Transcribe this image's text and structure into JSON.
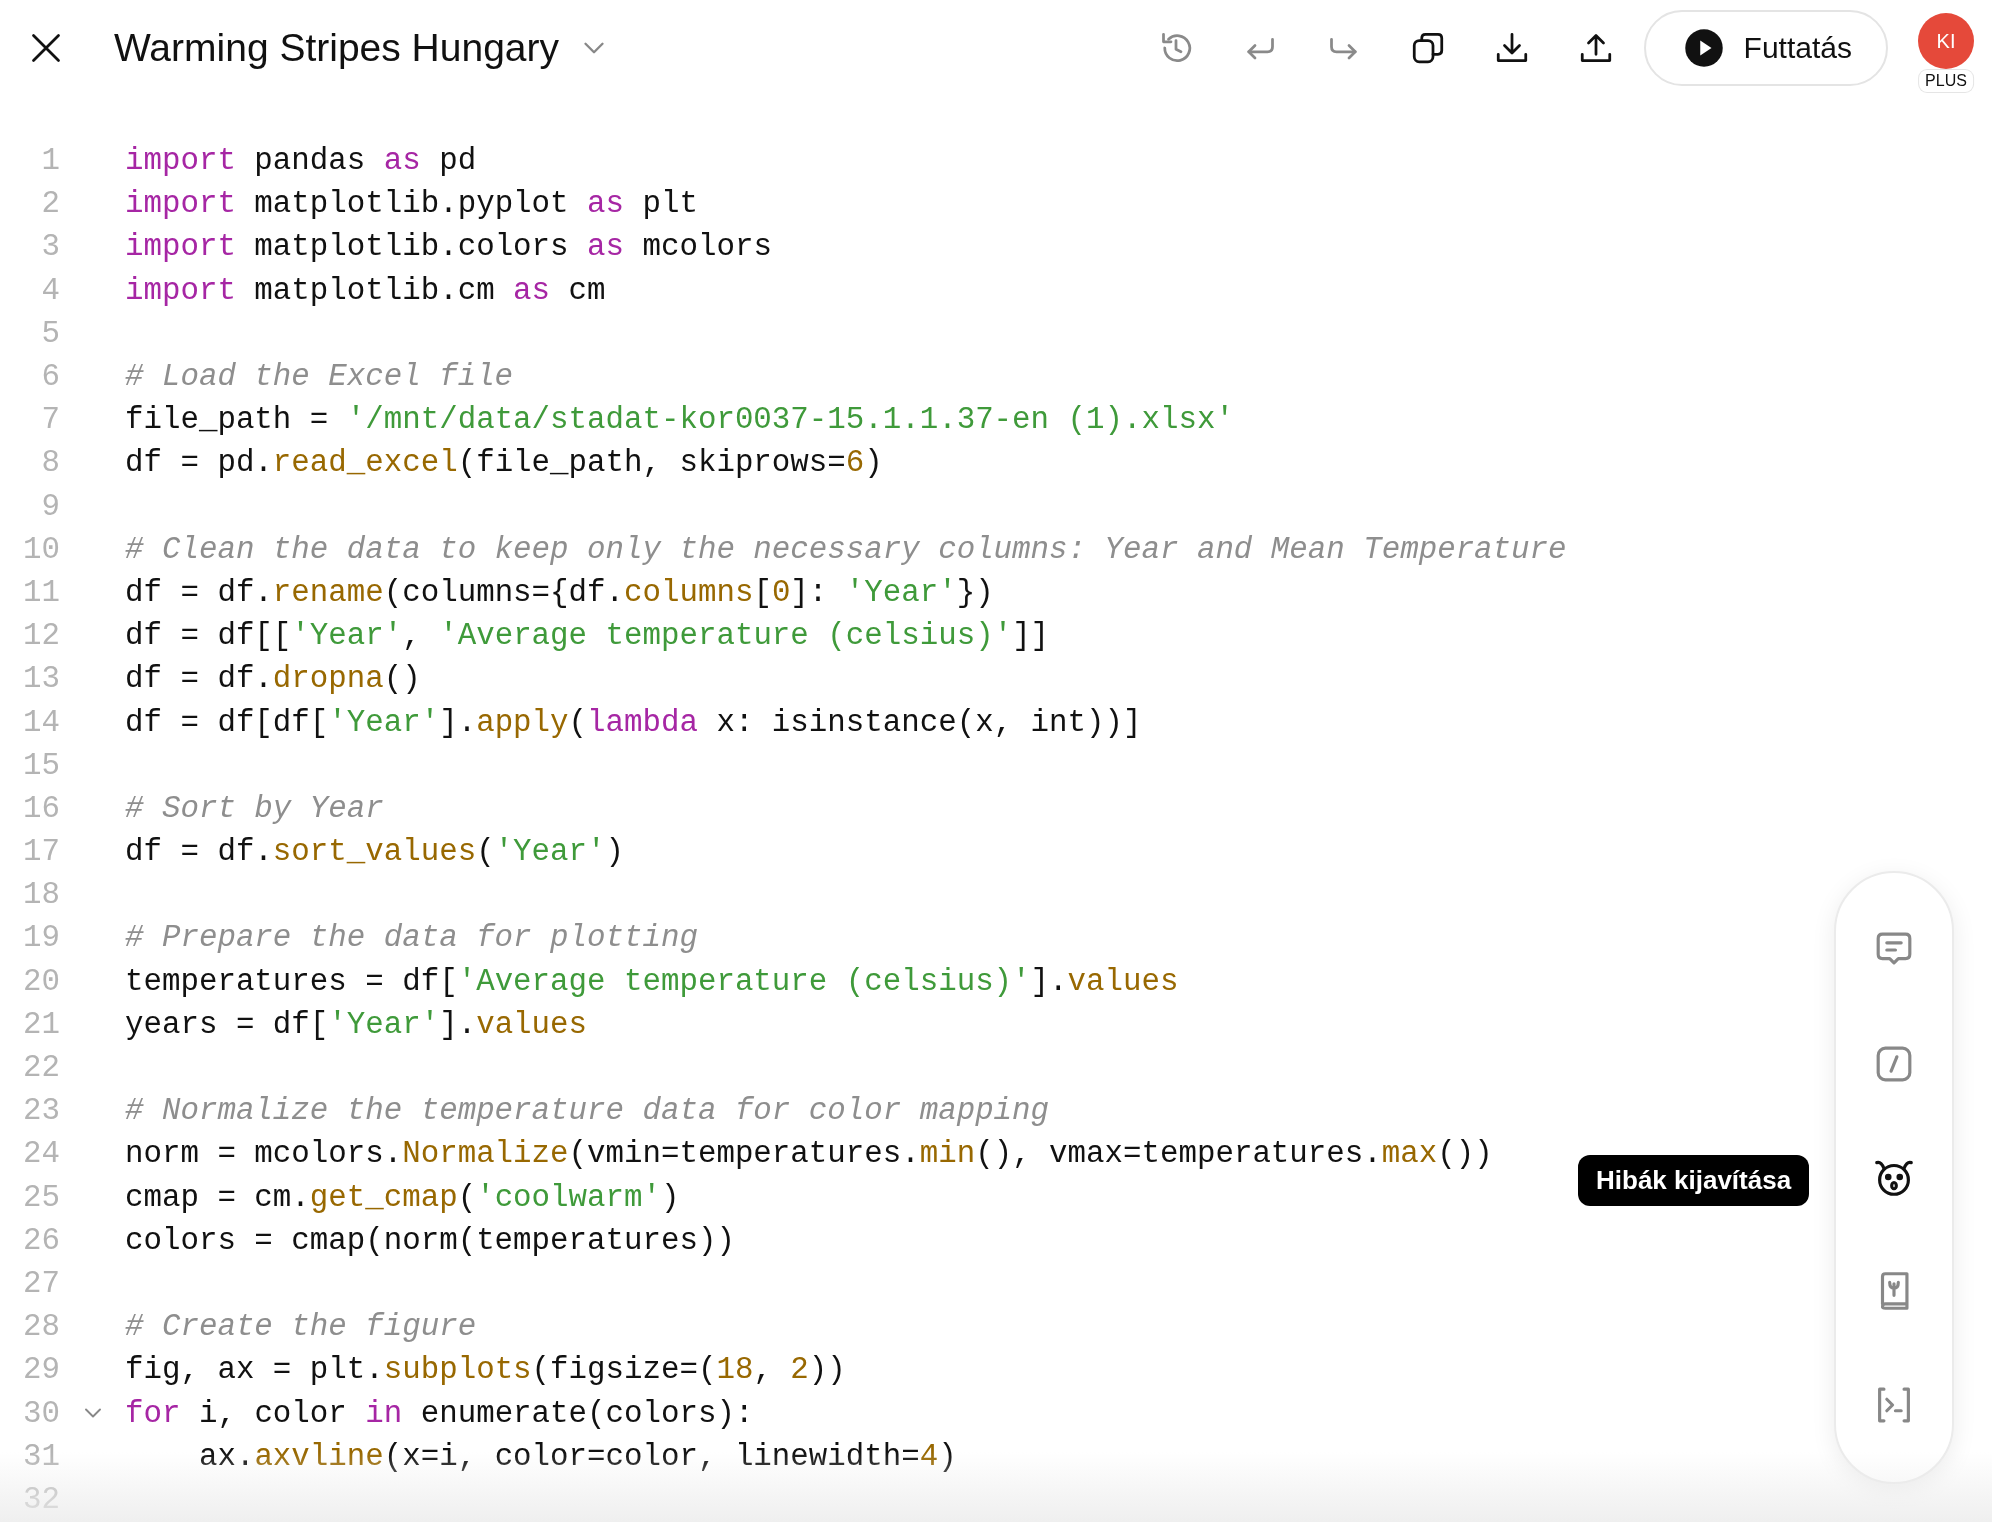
{
  "header": {
    "title": "Warming Stripes Hungary",
    "toolbar": [
      {
        "kind": "history",
        "disabled": true
      },
      {
        "kind": "undo",
        "disabled": true
      },
      {
        "kind": "redo",
        "disabled": true
      },
      {
        "kind": "copy",
        "disabled": false
      },
      {
        "kind": "download",
        "disabled": false
      },
      {
        "kind": "upload",
        "disabled": false
      }
    ],
    "run_button": "Futtatás",
    "avatar": {
      "initials": "KI",
      "badge": "PLUS"
    }
  },
  "code": [
    {
      "number": "1",
      "kind": "plain",
      "tokens": [
        {
          "kind": "kw",
          "text": "import"
        },
        {
          "kind": "plain",
          "text": " pandas "
        },
        {
          "kind": "kw",
          "text": "as"
        },
        {
          "kind": "plain",
          "text": " pd"
        }
      ]
    },
    {
      "number": "2",
      "kind": "plain",
      "tokens": [
        {
          "kind": "kw",
          "text": "import"
        },
        {
          "kind": "plain",
          "text": " matplotlib.pyplot "
        },
        {
          "kind": "kw",
          "text": "as"
        },
        {
          "kind": "plain",
          "text": " plt"
        }
      ]
    },
    {
      "number": "3",
      "kind": "plain",
      "tokens": [
        {
          "kind": "kw",
          "text": "import"
        },
        {
          "kind": "plain",
          "text": " matplotlib.colors "
        },
        {
          "kind": "kw",
          "text": "as"
        },
        {
          "kind": "plain",
          "text": " mcolors"
        }
      ]
    },
    {
      "number": "4",
      "kind": "plain",
      "tokens": [
        {
          "kind": "kw",
          "text": "import"
        },
        {
          "kind": "plain",
          "text": " matplotlib.cm "
        },
        {
          "kind": "kw",
          "text": "as"
        },
        {
          "kind": "plain",
          "text": " cm"
        }
      ]
    },
    {
      "number": "5",
      "kind": "plain"
    },
    {
      "number": "6",
      "kind": "plain",
      "tokens": [
        {
          "kind": "com",
          "text": "# Load the Excel file"
        }
      ]
    },
    {
      "number": "7",
      "kind": "plain",
      "tokens": [
        {
          "kind": "plain",
          "text": "file_path = "
        },
        {
          "kind": "str",
          "text": "'/mnt/data/stadat-kor0037-15.1.1.37-en (1).xlsx'"
        }
      ]
    },
    {
      "number": "8",
      "kind": "plain",
      "tokens": [
        {
          "kind": "plain",
          "text": "df = pd."
        },
        {
          "kind": "fn",
          "text": "read_excel"
        },
        {
          "kind": "plain",
          "text": "(file_path, skiprows="
        },
        {
          "kind": "num",
          "text": "6"
        },
        {
          "kind": "plain",
          "text": ")"
        }
      ]
    },
    {
      "number": "9",
      "kind": "plain"
    },
    {
      "number": "10",
      "kind": "plain",
      "tokens": [
        {
          "kind": "com",
          "text": "# Clean the data to keep only the necessary columns: Year and Mean Temperature"
        }
      ]
    },
    {
      "number": "11",
      "kind": "plain",
      "tokens": [
        {
          "kind": "plain",
          "text": "df = df."
        },
        {
          "kind": "fn",
          "text": "rename"
        },
        {
          "kind": "plain",
          "text": "(columns={df."
        },
        {
          "kind": "fn",
          "text": "columns"
        },
        {
          "kind": "plain",
          "text": "["
        },
        {
          "kind": "num",
          "text": "0"
        },
        {
          "kind": "plain",
          "text": "]: "
        },
        {
          "kind": "str",
          "text": "'Year'"
        },
        {
          "kind": "plain",
          "text": "})"
        }
      ]
    },
    {
      "number": "12",
      "kind": "plain",
      "tokens": [
        {
          "kind": "plain",
          "text": "df = df[["
        },
        {
          "kind": "str",
          "text": "'Year'"
        },
        {
          "kind": "plain",
          "text": ", "
        },
        {
          "kind": "str",
          "text": "'Average temperature (celsius)'"
        },
        {
          "kind": "plain",
          "text": "]]"
        }
      ]
    },
    {
      "number": "13",
      "kind": "plain",
      "tokens": [
        {
          "kind": "plain",
          "text": "df = df."
        },
        {
          "kind": "fn",
          "text": "dropna"
        },
        {
          "kind": "plain",
          "text": "()"
        }
      ]
    },
    {
      "number": "14",
      "kind": "plain",
      "tokens": [
        {
          "kind": "plain",
          "text": "df = df[df["
        },
        {
          "kind": "str",
          "text": "'Year'"
        },
        {
          "kind": "plain",
          "text": "]."
        },
        {
          "kind": "fn",
          "text": "apply"
        },
        {
          "kind": "plain",
          "text": "("
        },
        {
          "kind": "kw",
          "text": "lambda"
        },
        {
          "kind": "plain",
          "text": " x: isinstance(x, int))]"
        }
      ]
    },
    {
      "number": "15",
      "kind": "plain"
    },
    {
      "number": "16",
      "kind": "plain",
      "tokens": [
        {
          "kind": "com",
          "text": "# Sort by Year"
        }
      ]
    },
    {
      "number": "17",
      "kind": "plain",
      "tokens": [
        {
          "kind": "plain",
          "text": "df = df."
        },
        {
          "kind": "fn",
          "text": "sort_values"
        },
        {
          "kind": "plain",
          "text": "("
        },
        {
          "kind": "str",
          "text": "'Year'"
        },
        {
          "kind": "plain",
          "text": ")"
        }
      ]
    },
    {
      "number": "18",
      "kind": "plain"
    },
    {
      "number": "19",
      "kind": "plain",
      "tokens": [
        {
          "kind": "com",
          "text": "# Prepare the data for plotting"
        }
      ]
    },
    {
      "number": "20",
      "kind": "plain",
      "tokens": [
        {
          "kind": "plain",
          "text": "temperatures = df["
        },
        {
          "kind": "str",
          "text": "'Average temperature (celsius)'"
        },
        {
          "kind": "plain",
          "text": "]."
        },
        {
          "kind": "fn",
          "text": "values"
        }
      ]
    },
    {
      "number": "21",
      "kind": "plain",
      "tokens": [
        {
          "kind": "plain",
          "text": "years = df["
        },
        {
          "kind": "str",
          "text": "'Year'"
        },
        {
          "kind": "plain",
          "text": "]."
        },
        {
          "kind": "fn",
          "text": "values"
        }
      ]
    },
    {
      "number": "22",
      "kind": "plain"
    },
    {
      "number": "23",
      "kind": "plain",
      "tokens": [
        {
          "kind": "com",
          "text": "# Normalize the temperature data for color mapping"
        }
      ]
    },
    {
      "number": "24",
      "kind": "plain",
      "tokens": [
        {
          "kind": "plain",
          "text": "norm = mcolors."
        },
        {
          "kind": "fn",
          "text": "Normalize"
        },
        {
          "kind": "plain",
          "text": "(vmin=temperatures."
        },
        {
          "kind": "fn",
          "text": "min"
        },
        {
          "kind": "plain",
          "text": "(), vmax=temperatures."
        },
        {
          "kind": "fn",
          "text": "max"
        },
        {
          "kind": "plain",
          "text": "())"
        }
      ]
    },
    {
      "number": "25",
      "kind": "plain",
      "tokens": [
        {
          "kind": "plain",
          "text": "cmap = cm."
        },
        {
          "kind": "fn",
          "text": "get_cmap"
        },
        {
          "kind": "plain",
          "text": "("
        },
        {
          "kind": "str",
          "text": "'coolwarm'"
        },
        {
          "kind": "plain",
          "text": ")"
        }
      ]
    },
    {
      "number": "26",
      "kind": "plain",
      "tokens": [
        {
          "kind": "plain",
          "text": "colors = cmap(norm(temperatures))"
        }
      ]
    },
    {
      "number": "27",
      "kind": "plain"
    },
    {
      "number": "28",
      "kind": "plain",
      "tokens": [
        {
          "kind": "com",
          "text": "# Create the figure"
        }
      ]
    },
    {
      "number": "29",
      "kind": "plain",
      "tokens": [
        {
          "kind": "plain",
          "text": "fig, ax = plt."
        },
        {
          "kind": "fn",
          "text": "subplots"
        },
        {
          "kind": "plain",
          "text": "(figsize=("
        },
        {
          "kind": "num",
          "text": "18"
        },
        {
          "kind": "plain",
          "text": ", "
        },
        {
          "kind": "num",
          "text": "2"
        },
        {
          "kind": "plain",
          "text": "))"
        }
      ]
    },
    {
      "number": "30",
      "kind": "foldable",
      "tokens": [
        {
          "kind": "kw",
          "text": "for"
        },
        {
          "kind": "plain",
          "text": " i, color "
        },
        {
          "kind": "kw",
          "text": "in"
        },
        {
          "kind": "plain",
          "text": " enumerate(colors):"
        }
      ]
    },
    {
      "number": "31",
      "kind": "plain",
      "tokens": [
        {
          "kind": "plain",
          "text": "    ax."
        },
        {
          "kind": "fn",
          "text": "axvline"
        },
        {
          "kind": "plain",
          "text": "(x=i, color=color, linewidth="
        },
        {
          "kind": "num",
          "text": "4"
        },
        {
          "kind": "plain",
          "text": ")"
        }
      ]
    },
    {
      "number": "32",
      "kind": "plain"
    }
  ],
  "side_tools": {
    "items": [
      {
        "kind": "comment",
        "selected": false
      },
      {
        "kind": "shortcut",
        "selected": false
      },
      {
        "kind": "bug",
        "selected": true
      },
      {
        "kind": "book",
        "selected": false
      },
      {
        "kind": "terminal",
        "selected": false
      }
    ],
    "tooltip": "Hibák kijavítása"
  }
}
